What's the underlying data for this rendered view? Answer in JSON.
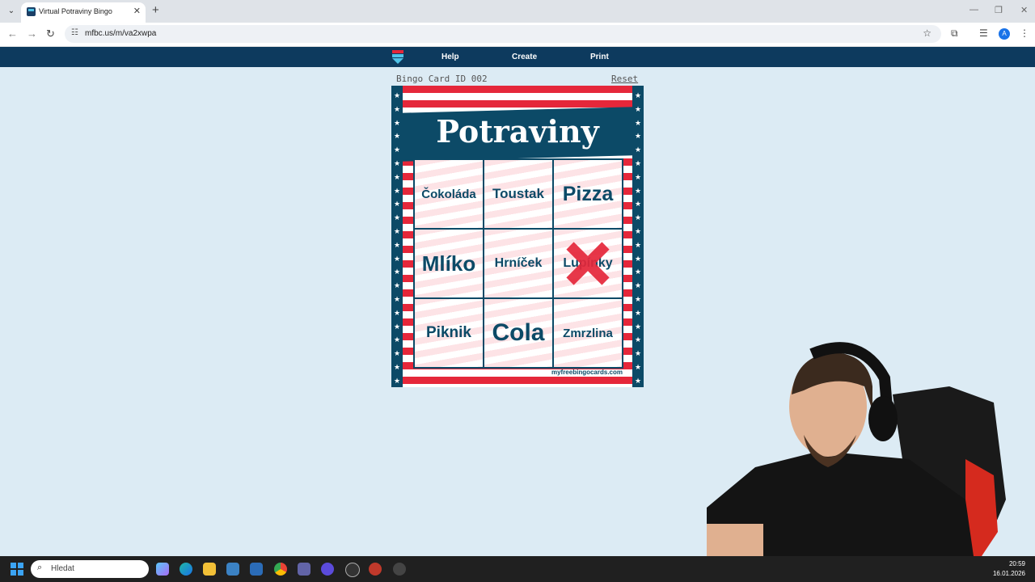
{
  "browser": {
    "tab_title": "Virtual Potraviny Bingo",
    "url": "mfbc.us/m/va2xwpa",
    "profile_initial": "A"
  },
  "site_nav": {
    "help": "Help",
    "create": "Create",
    "print": "Print"
  },
  "card": {
    "id_label": "Bingo Card ID 002",
    "reset_label": "Reset",
    "title": "Potraviny",
    "cells": [
      {
        "text": "Čokoláda",
        "marked": false
      },
      {
        "text": "Toustak",
        "marked": false
      },
      {
        "text": "Pizza",
        "marked": false
      },
      {
        "text": "Mlíko",
        "marked": false
      },
      {
        "text": "Hrníček",
        "marked": false
      },
      {
        "text": "Lupínky",
        "marked": true
      },
      {
        "text": "Piknik",
        "marked": false
      },
      {
        "text": "Cola",
        "marked": false
      },
      {
        "text": "Zmrzlina",
        "marked": false
      }
    ],
    "footer": "myfreebingocards.com",
    "colors": {
      "navy": "#0c4a67",
      "red": "#e5273a",
      "mark": "#e5273a"
    }
  },
  "taskbar": {
    "search_placeholder": "Hledat",
    "time": "20:59",
    "date": "16.01.2026"
  }
}
